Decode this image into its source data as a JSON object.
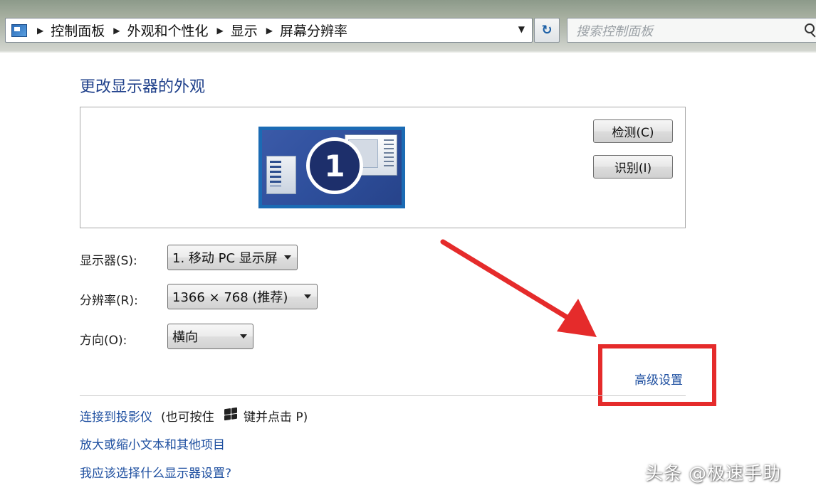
{
  "address_bar": {
    "crumbs": [
      "控制面板",
      "外观和个性化",
      "显示",
      "屏幕分辨率"
    ],
    "search_placeholder": "搜索控制面板"
  },
  "page": {
    "title": "更改显示器的外观",
    "monitor_number": "1",
    "detect_label": "检测(C)",
    "identify_label": "识别(I)"
  },
  "settings": {
    "display_label": "显示器(S):",
    "display_value": "1. 移动 PC 显示屏",
    "resolution_label": "分辨率(R):",
    "resolution_value": "1366 × 768 (推荐)",
    "orientation_label": "方向(O):",
    "orientation_value": "横向",
    "advanced_link": "高级设置"
  },
  "links": {
    "projector_link": "连接到投影仪",
    "projector_hint_pre": "(也可按住",
    "projector_hint_post": "键并点击 P)",
    "text_size_link": "放大或缩小文本和其他项目",
    "which_settings_link": "我应该选择什么显示器设置?"
  },
  "annotation": {
    "color": "#e52b2b"
  },
  "watermark": "头条 @极速手助"
}
